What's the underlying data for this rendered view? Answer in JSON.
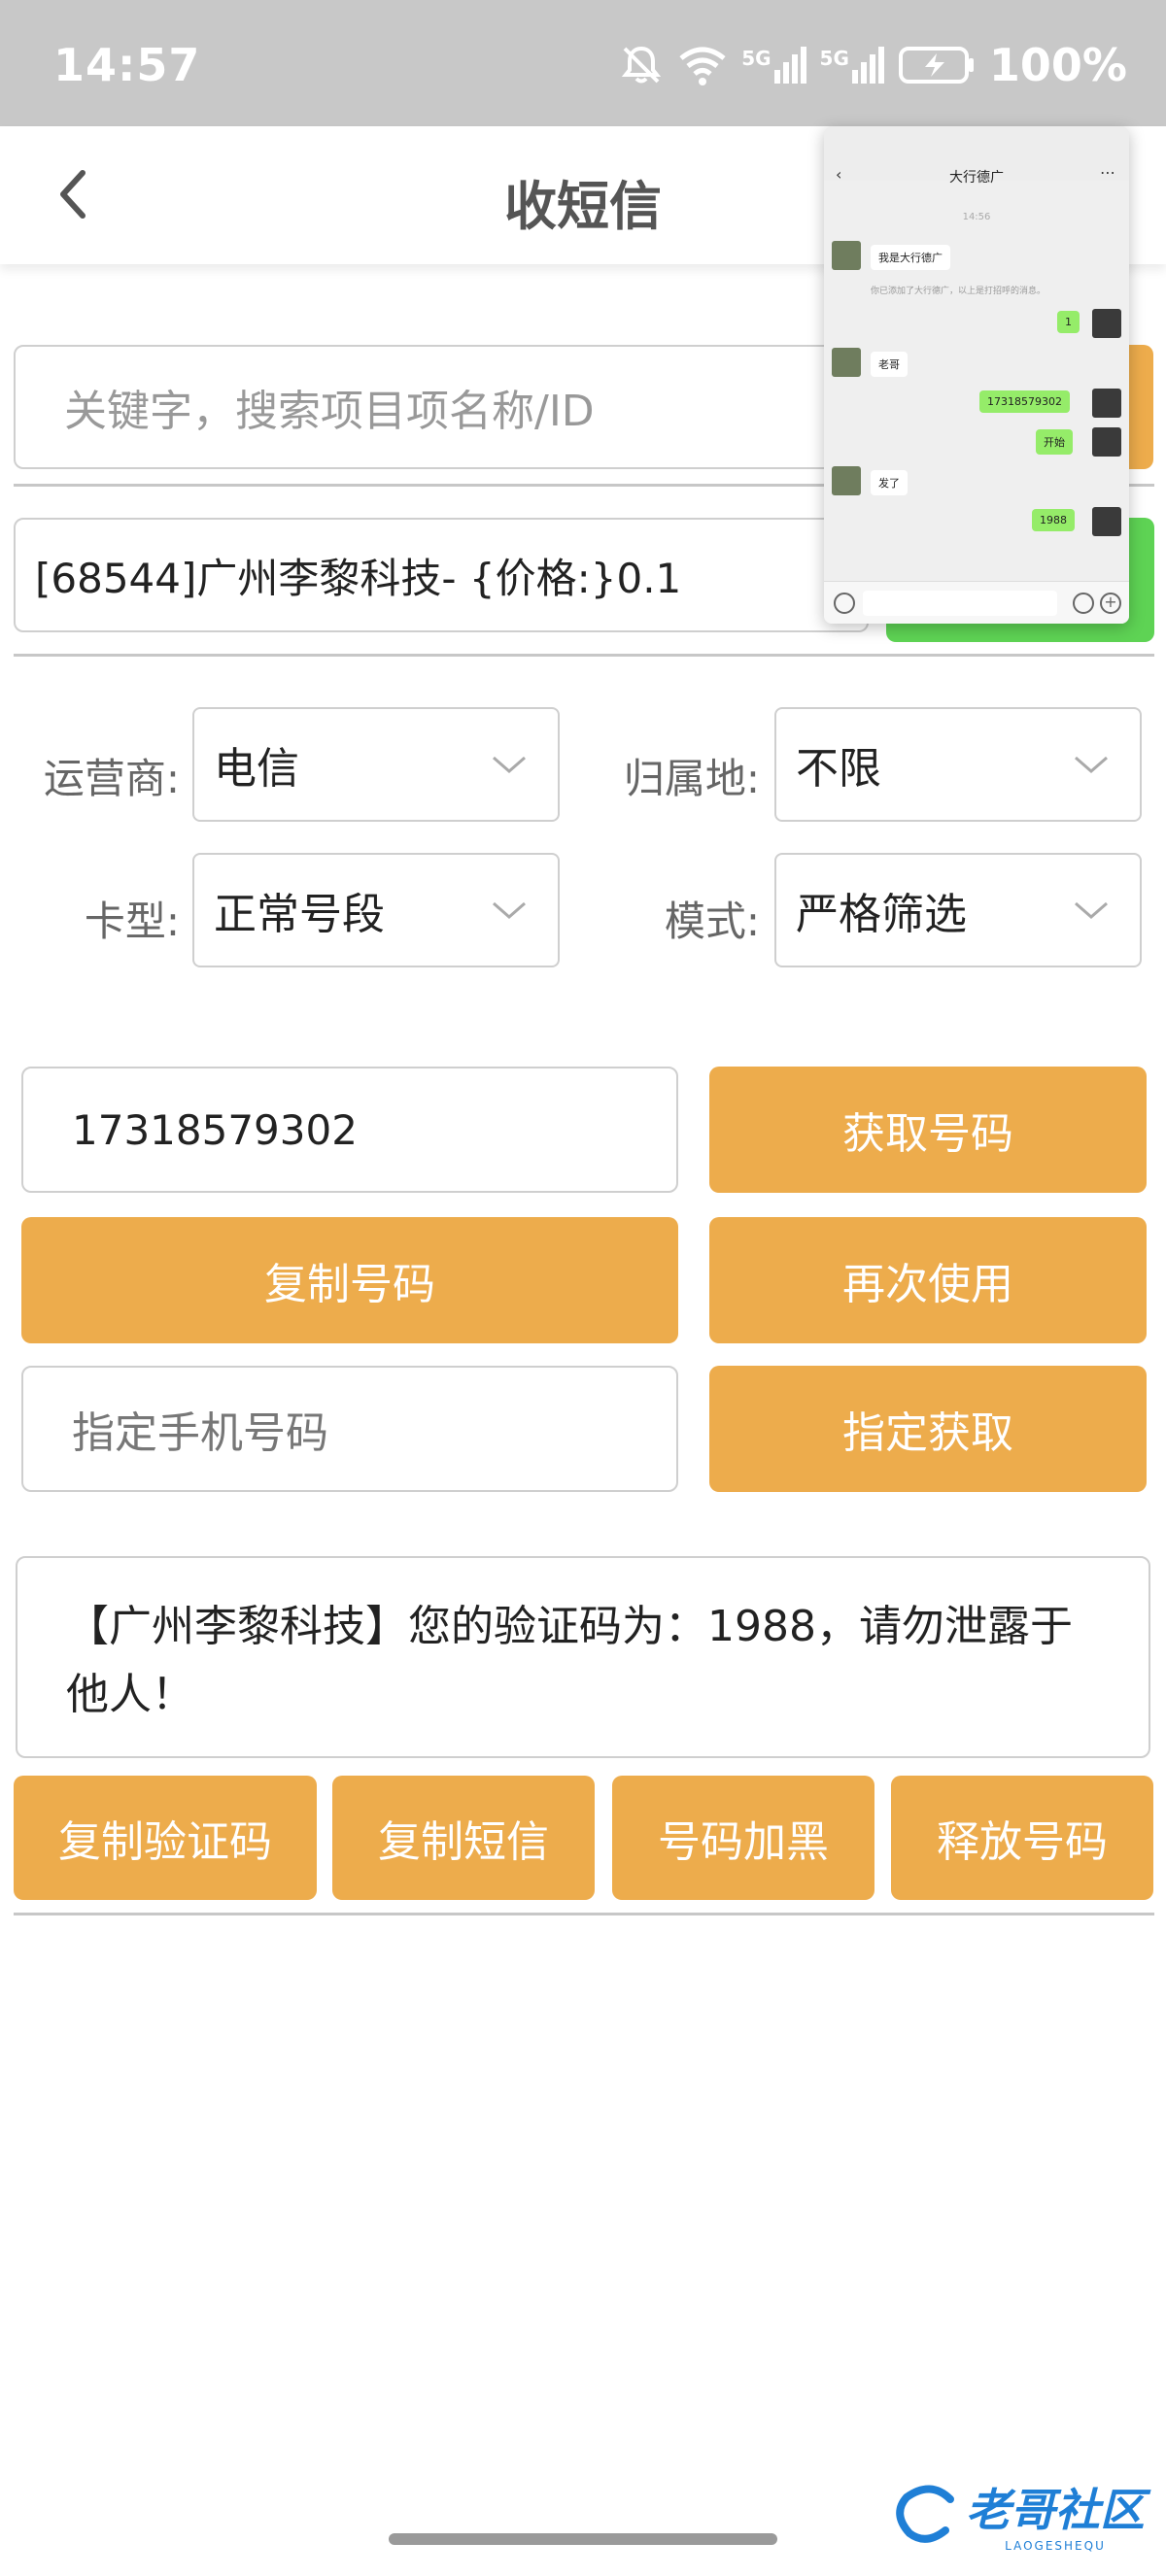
{
  "status_bar": {
    "time": "14:57",
    "network": "5G",
    "network2": "5G",
    "battery": "100%"
  },
  "header": {
    "title": "收短信"
  },
  "search": {
    "keyword_placeholder": "关键字，搜索项目项名称/ID",
    "selected_project": "[68544]广州李黎科技- {价格:}0.1"
  },
  "filters": {
    "carrier_label": "运营商:",
    "carrier_value": "电信",
    "region_label": "归属地:",
    "region_value": "不限",
    "card_label": "卡型:",
    "card_value": "正常号段",
    "mode_label": "模式:",
    "mode_value": "严格筛选"
  },
  "actions": {
    "phone_number": "17318579302",
    "get_number": "获取号码",
    "copy_number": "复制号码",
    "reuse": "再次使用",
    "assign_placeholder": "指定手机号码",
    "assign_get": "指定获取"
  },
  "sms": {
    "content": "【广州李黎科技】您的验证码为：1988，请勿泄露于他人！"
  },
  "bottom_buttons": {
    "copy_code": "复制验证码",
    "copy_sms": "复制短信",
    "blacklist": "号码加黑",
    "release": "释放号码"
  },
  "overlay_chat": {
    "title": "大行德广",
    "time": "14:56",
    "messages": [
      {
        "side": "left",
        "text": "我是大行德广"
      },
      {
        "side": "note",
        "text": "你已添加了大行德广，以上是打招呼的消息。"
      },
      {
        "side": "right",
        "text": "1"
      },
      {
        "side": "left",
        "text": "老哥"
      },
      {
        "side": "right",
        "text": "17318579302"
      },
      {
        "side": "right",
        "text": "开始"
      },
      {
        "side": "left",
        "text": "发了"
      },
      {
        "side": "right",
        "text": "1988"
      }
    ]
  },
  "watermark": {
    "text": "老哥社区",
    "sub": "LAOGESHEQU"
  },
  "colors": {
    "accent_orange": "#edac4c",
    "accent_green": "#5ed354",
    "status_bar": "#c8c8c8"
  }
}
